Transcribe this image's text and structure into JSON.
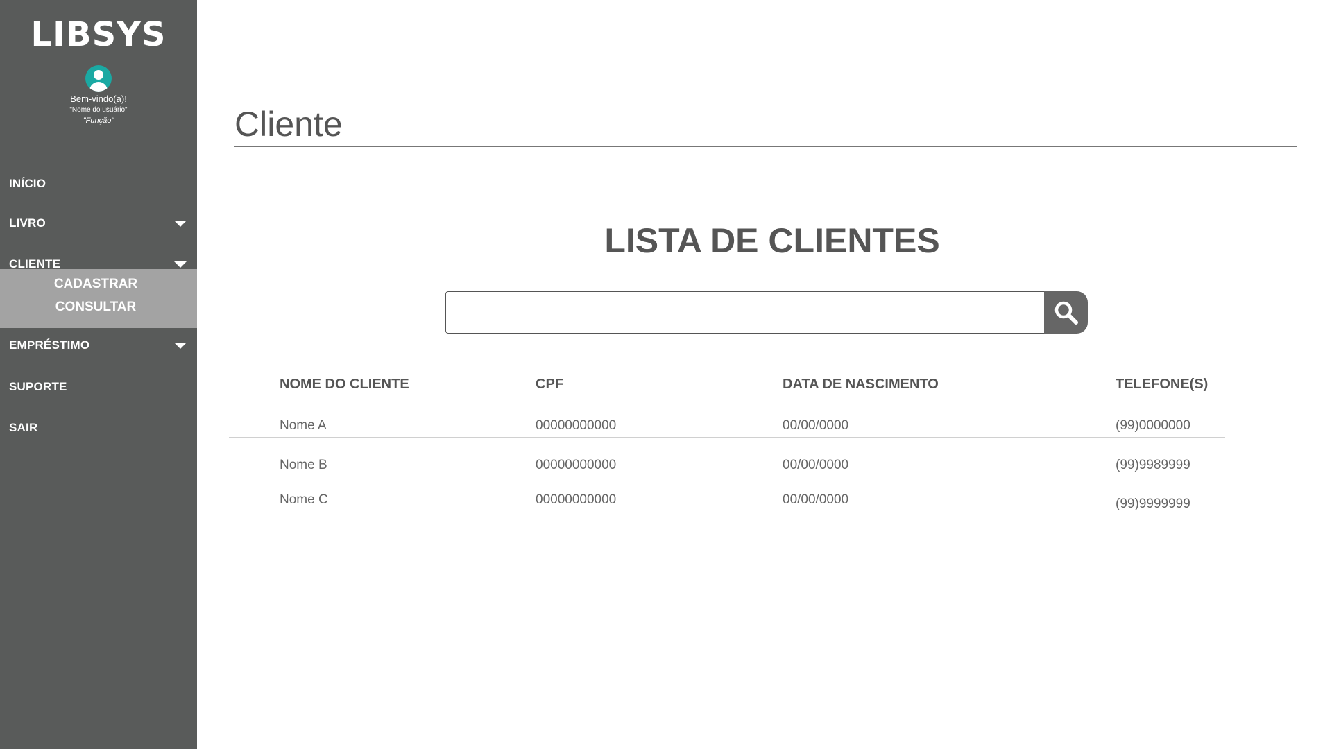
{
  "sidebar": {
    "brand": "LIBSYS",
    "welcome": "Bem-vindo(a)!",
    "user_name": "\"Nome do usuário\"",
    "user_role": "\"Função\"",
    "menu": {
      "inicio": "INÍCIO",
      "livro": "LIVRO",
      "cliente": "CLIENTE",
      "cliente_sub": [
        "CADASTRAR",
        "CONSULTAR"
      ],
      "emprestimo": "EMPRÉSTIMO",
      "suporte": "SUPORTE",
      "sair": "SAIR"
    },
    "colors": {
      "background": "#595b5a",
      "submenu": "#a3a3a3",
      "avatar": "#1aa9a3"
    }
  },
  "main": {
    "page_title": "Cliente",
    "list_title": "LISTA DE CLIENTES",
    "search": {
      "value": "",
      "placeholder": "",
      "icon": "search-icon"
    },
    "table": {
      "headers": [
        "NOME DO CLIENTE",
        "CPF",
        "DATA DE NASCIMENTO",
        "TELEFONE(S)"
      ],
      "rows": [
        {
          "nome": "Nome A",
          "cpf": "00000000000",
          "nascimento": "00/00/0000",
          "telefone": "(99)0000000"
        },
        {
          "nome": "Nome B",
          "cpf": "00000000000",
          "nascimento": "00/00/0000",
          "telefone": "(99)9989999"
        },
        {
          "nome": "Nome C",
          "cpf": "00000000000",
          "nascimento": "00/00/0000",
          "telefone": "(99)9999999"
        }
      ]
    }
  }
}
